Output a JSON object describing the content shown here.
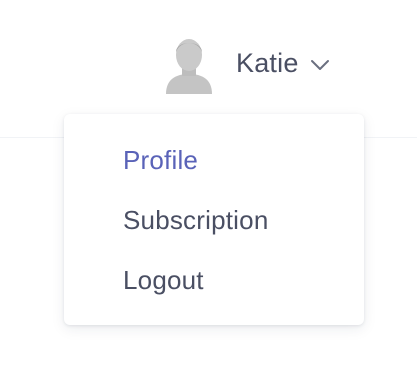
{
  "user": {
    "name": "Katie",
    "avatar_icon": "user-avatar-icon",
    "chevron_icon": "chevron-down-icon"
  },
  "dropdown": {
    "items": [
      {
        "label": "Profile",
        "active": true
      },
      {
        "label": "Subscription",
        "active": false
      },
      {
        "label": "Logout",
        "active": false
      }
    ]
  },
  "colors": {
    "text": "#4a4f63",
    "active": "#5a63b8",
    "avatar": "#c4c4c4"
  }
}
